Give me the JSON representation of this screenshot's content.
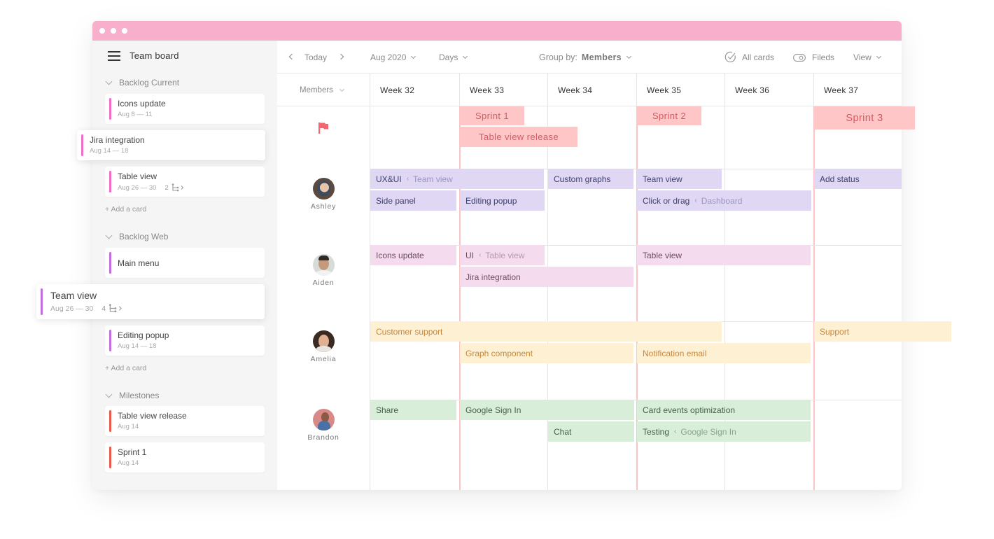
{
  "window": {
    "titlebar_color": "#f8afcc",
    "dots": 3
  },
  "sidebar": {
    "title": "Team board",
    "menu_icon": "hamburger-icon",
    "groups": [
      {
        "name": "Backlog Current",
        "cards": [
          {
            "title": "Icons update",
            "date": "Aug 8 — 11",
            "color": "#f06dc9"
          },
          {
            "title": "Jira integration",
            "date": "Aug 14 — 18",
            "color": "#f06dc9",
            "floating": true
          },
          {
            "title": "Table view",
            "date": "Aug 26 — 30",
            "subtasks": "2",
            "color": "#f06dc9"
          }
        ],
        "add_label": "+ Add a card"
      },
      {
        "name": "Backlog Web",
        "cards": [
          {
            "title": "Main menu",
            "date": "",
            "color": "#c56ee0"
          },
          {
            "title": "Team view",
            "date": "Aug 26 — 30",
            "subtasks": "4",
            "color": "#c56ee0",
            "floating": true
          },
          {
            "title": "Editing popup",
            "date": "Aug 14 — 18",
            "color": "#c56ee0"
          }
        ],
        "add_label": "+ Add a card"
      },
      {
        "name": "Milestones",
        "cards": [
          {
            "title": "Table view release",
            "date": "Aug 14",
            "color": "#ea5a4a"
          },
          {
            "title": "Sprint 1",
            "date": "Aug 14",
            "color": "#ea5a4a"
          }
        ]
      }
    ]
  },
  "toolbar": {
    "today": "Today",
    "month": "Aug 2020",
    "scale": "Days",
    "group_by_label": "Group by:",
    "group_by_value": "Members",
    "all_cards": "All cards",
    "fields": "Fileds",
    "view": "View"
  },
  "grid": {
    "members_header": "Members",
    "weeks": [
      "Week 32",
      "Week 33",
      "Week 34",
      "Week 35",
      "Week 36",
      "Week 37"
    ],
    "milestones": [
      {
        "label": "Sprint 1"
      },
      {
        "label": "Table view release"
      },
      {
        "label": "Sprint 2"
      },
      {
        "label": "Sprint 3"
      }
    ],
    "members": [
      {
        "name": "Ashley"
      },
      {
        "name": "Aiden"
      },
      {
        "name": "Amelia"
      },
      {
        "name": "Brandon"
      }
    ],
    "events": {
      "ashley": [
        {
          "title": "UX&UI",
          "parent": "Team view"
        },
        {
          "title": "Custom graphs"
        },
        {
          "title": "Team view"
        },
        {
          "title": "Add status"
        },
        {
          "title": "Side panel"
        },
        {
          "title": "Editing popup"
        },
        {
          "title": "Click or drag",
          "parent": "Dashboard"
        }
      ],
      "aiden": [
        {
          "title": "Icons update"
        },
        {
          "title": "UI",
          "parent": "Table view"
        },
        {
          "title": "Table view"
        },
        {
          "title": "Jira integration"
        }
      ],
      "amelia": [
        {
          "title": "Customer support"
        },
        {
          "title": "Support"
        },
        {
          "title": "Graph component"
        },
        {
          "title": "Notification email"
        }
      ],
      "brandon": [
        {
          "title": "Share"
        },
        {
          "title": "Google Sign In"
        },
        {
          "title": "Card events optimization"
        },
        {
          "title": "Chat"
        },
        {
          "title": "Testing",
          "parent": "Google Sign In"
        }
      ]
    },
    "colors": {
      "milestone_bg": "#fec6c6",
      "milestone_text": "#d45a63",
      "purple_bg": "#e0d7f4",
      "purple_text": "#3d3f6b",
      "pink_bg": "#f4dbee",
      "pink_text": "#6e4a62",
      "yellow_bg": "#fdf0d3",
      "yellow_text": "#c8873a",
      "green_bg": "#d8eed9",
      "green_text": "#45604a"
    }
  }
}
